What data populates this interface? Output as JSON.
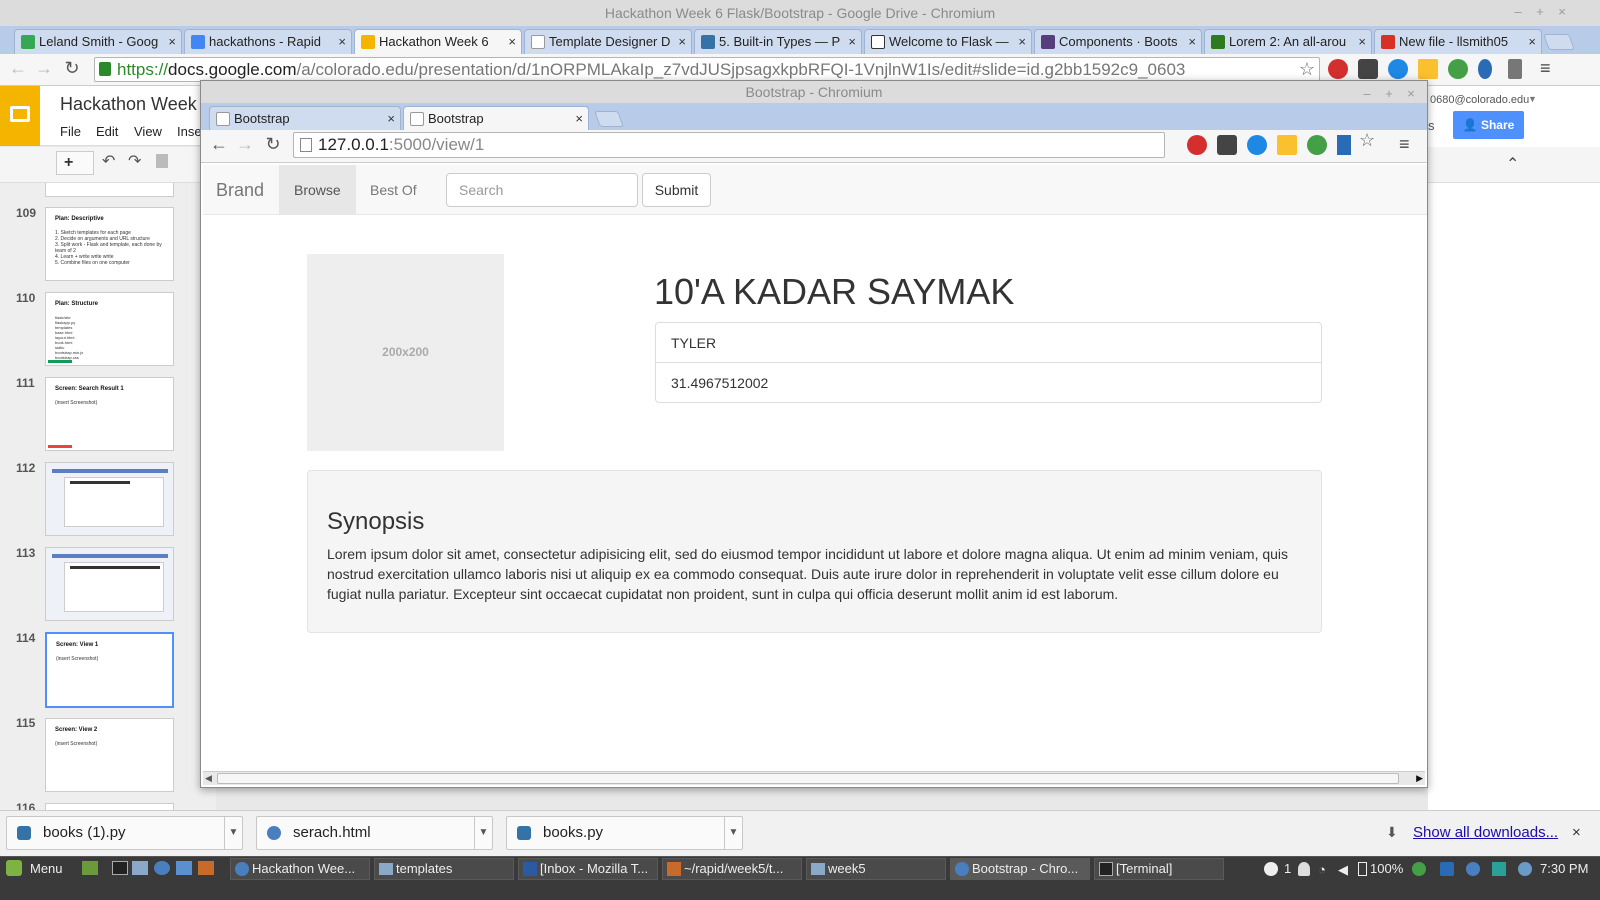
{
  "outer_window": {
    "title": "Hackathon Week 6 Flask/Bootstrap - Google Drive - Chromium",
    "tabs": [
      {
        "label": "Leland Smith - Goog",
        "icon": "google-drive-icon"
      },
      {
        "label": "hackathons - Rapid",
        "icon": "google-docs-icon"
      },
      {
        "label": "Hackathon Week 6",
        "icon": "google-slides-icon",
        "active": true
      },
      {
        "label": "Template Designer D",
        "icon": "page-icon"
      },
      {
        "label": "5. Built-in Types — P",
        "icon": "python-icon"
      },
      {
        "label": "Welcome to Flask —",
        "icon": "flask-icon"
      },
      {
        "label": "Components · Boots",
        "icon": "bootstrap-icon"
      },
      {
        "label": "Lorem 2: An all-arou",
        "icon": "lorem-icon"
      },
      {
        "label": "New file - llsmith05",
        "icon": "gmail-icon"
      }
    ],
    "url_scheme": "https://",
    "url_domain": "docs.google.com",
    "url_path": "/a/colorado.edu/presentation/d/1nORPMLAkaIp_z7vdJUSjpsagxkpbRFQI-1VnjlnW1Is/edit#slide=id.g2bb1592c9_0603"
  },
  "slides_app": {
    "doc_title": "Hackathon Week",
    "menu": [
      "File",
      "Edit",
      "View",
      "Inse"
    ],
    "account_email": "0680@colorado.edu",
    "share_label": "Share",
    "slides": [
      {
        "num": "109",
        "title": "Plan: Descriptive",
        "body": [
          "1. Sketch templates for each page",
          "2. Decide on arguments and URL structure",
          "3. Split work - Flask and template, each done by team of 2",
          "4. Learn + write write write",
          "5. Combine files on one computer"
        ]
      },
      {
        "num": "110",
        "title": "Plan: Structure",
        "body": [
          "flask/site",
          "  flaskapp.py",
          "  templates",
          "    base.html",
          "    layout.html",
          "    book.html",
          "  static",
          "    bootstrap.min.js",
          "    bootstrap.css"
        ]
      },
      {
        "num": "111",
        "title": "Screen: Search Result 1",
        "body": [
          "(insert Screenshot)"
        ]
      },
      {
        "num": "112",
        "title": "",
        "body": []
      },
      {
        "num": "113",
        "title": "",
        "body": []
      },
      {
        "num": "114",
        "title": "Screen: View 1",
        "body": [
          "(insert Screenshot)"
        ],
        "selected": true
      },
      {
        "num": "115",
        "title": "Screen: View 2",
        "body": [
          "(insert Screenshot)"
        ]
      },
      {
        "num": "116",
        "title": "",
        "body": []
      }
    ]
  },
  "inner_window": {
    "title": "Bootstrap - Chromium",
    "tabs": [
      {
        "label": "Bootstrap",
        "active": false
      },
      {
        "label": "Bootstrap",
        "active": true
      }
    ],
    "url_domain": "127.0.0.1",
    "url_path": ":5000/view/1"
  },
  "page": {
    "brand": "Brand",
    "nav": [
      {
        "label": "Browse",
        "active": true
      },
      {
        "label": "Best Of",
        "active": false
      }
    ],
    "search_placeholder": "Search",
    "submit_label": "Submit",
    "image_placeholder": "200x200",
    "heading": "10'A KADAR SAYMAK",
    "list_items": [
      "TYLER",
      "31.4967512002"
    ],
    "synopsis_title": "Synopsis",
    "synopsis_text": "Lorem ipsum dolor sit amet, consectetur adipisicing elit, sed do eiusmod tempor incididunt ut labore et dolore magna aliqua. Ut enim ad minim veniam, quis nostrud exercitation ullamco laboris nisi ut aliquip ex ea commodo consequat. Duis aute irure dolor in reprehenderit in voluptate velit esse cillum dolore eu fugiat nulla pariatur. Excepteur sint occaecat cupidatat non proident, sunt in culpa qui officia deserunt mollit anim id est laborum."
  },
  "downloads": {
    "items": [
      {
        "name": "books (1).py",
        "icon": "python-file-icon"
      },
      {
        "name": "serach.html",
        "icon": "html-file-icon"
      },
      {
        "name": "books.py",
        "icon": "python-file-icon"
      }
    ],
    "show_all": "Show all downloads..."
  },
  "taskbar": {
    "menu_label": "Menu",
    "windows": [
      {
        "label": "Hackathon Wee..."
      },
      {
        "label": "templates"
      },
      {
        "label": "[Inbox - Mozilla T..."
      },
      {
        "label": "~/rapid/week5/t..."
      },
      {
        "label": "week5"
      },
      {
        "label": "Bootstrap - Chro..."
      },
      {
        "label": "[Terminal]"
      }
    ],
    "tray_count": "1",
    "battery": "100%",
    "clock": "7:30 PM"
  },
  "colors": {
    "tab_bar": "#b8cbe8",
    "slides_yellow": "#f4b400",
    "share_blue": "#4d90fe",
    "link_blue": "#1a0dab"
  }
}
